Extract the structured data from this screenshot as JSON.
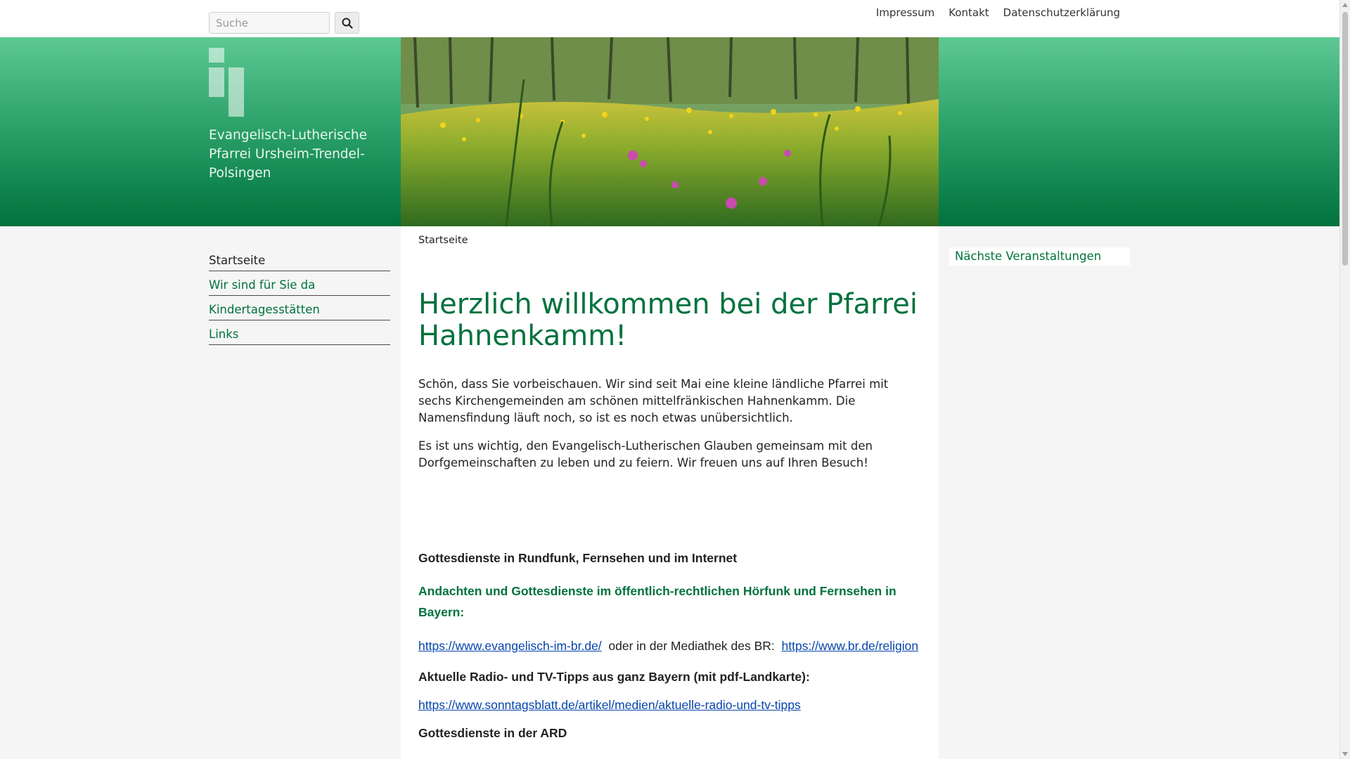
{
  "topbar": {
    "search": {
      "placeholder": "Suche",
      "value": "",
      "icon": "search-icon"
    },
    "links": [
      "Impressum",
      "Kontakt",
      "Datenschutzerklärung"
    ]
  },
  "header": {
    "org_name": "Evangelisch-Lutherische Pfarrei Ursheim-Trendel-Polsingen",
    "gradient_colors": [
      "#5ec894",
      "#2ba169",
      "#00723d"
    ]
  },
  "nav": {
    "items": [
      "Startseite",
      "Wir sind für Sie da",
      "Kindertagesstätten",
      "Links"
    ],
    "active": "Startseite"
  },
  "main": {
    "breadcrumb": "Startseite",
    "title": "Herzlich willkommen bei der Pfarrei Hahnenkamm!",
    "paragraphs": [
      "Schön, dass Sie vorbeischauen. Wir sind seit Mai eine kleine ländliche Pfarrei mit sechs Kirchengemeinden am schönen mittelfränkischen Hahnenkamm. Die Namensfindung läuft noch, so ist es noch etwas unübersichtlich.",
      "Es ist uns wichtig, den Evangelisch-Lutherischen Glauben gemeinsam mit den Dorfgemeinschaften zu leben und zu feiern. Wir freuen uns auf Ihren Besuch!"
    ],
    "section_heading": "Gottesdienste in Rundfunk, Fernsehen und im Internet",
    "bavaria_heading": "Andachten und Gottesdienste im öffentlich-rechtlichen Hörfunk und Fernsehen in Bayern:",
    "links_row": {
      "link1": "https://www.evangelisch-im-br.de/",
      "middle": "oder in der Mediathek des BR:",
      "link2": "https://www.br.de/religion"
    },
    "radio_heading": "Aktuelle Radio- und TV-Tipps aus ganz Bayern (mit pdf-Landkarte):",
    "radio_link": "https://www.sonntagsblatt.de/artikel/medien/aktuelle-radio-und-tv-tipps",
    "ard_heading": "Gottesdienste in der ARD"
  },
  "sidebar": {
    "events_title": "Nächste Veranstaltungen"
  },
  "colors": {
    "accent_green": "#00723d",
    "link_blue": "#0645ad"
  }
}
